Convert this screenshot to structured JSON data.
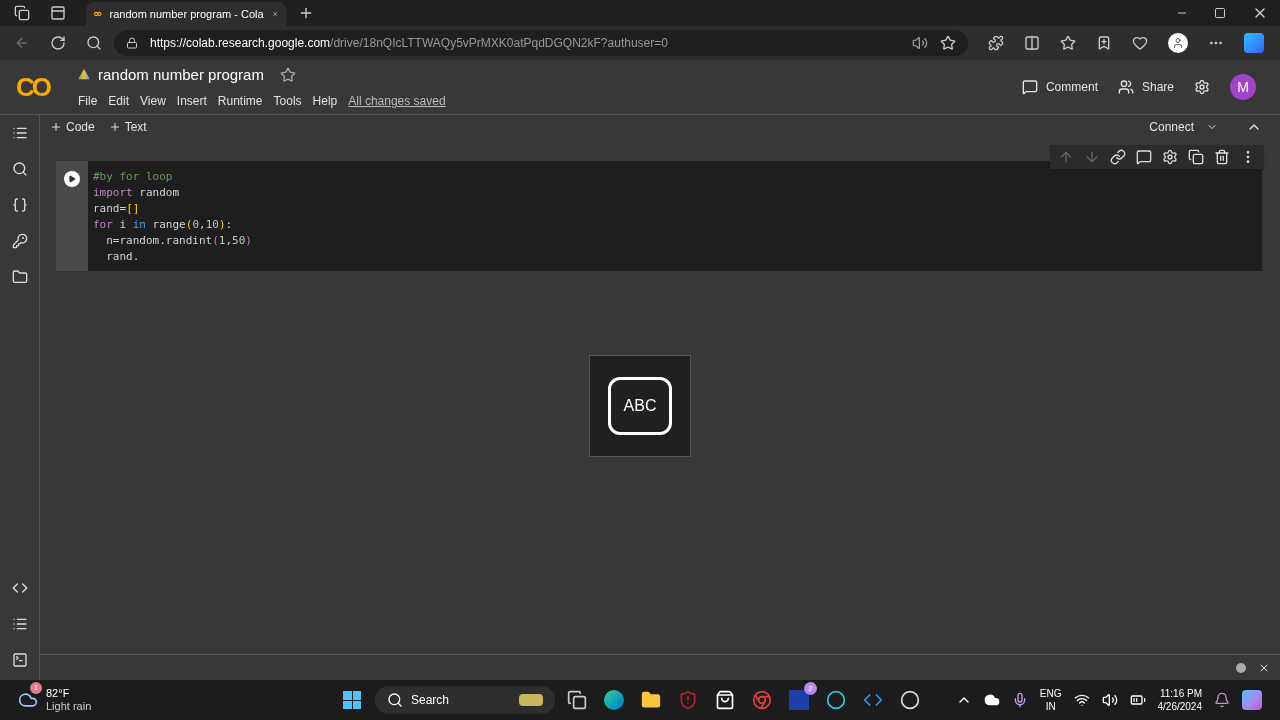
{
  "browser": {
    "tab": {
      "title": "random number program - Cola",
      "selected": true
    },
    "url": {
      "host": "https://colab.research.google.com",
      "path": "/drive/18nQIcLTTWAQy5vPrMXK0atPqdDGQN2kF?authuser=0"
    }
  },
  "notebook": {
    "logo": "CO",
    "title": "random number program",
    "menu": [
      "File",
      "Edit",
      "View",
      "Insert",
      "Runtime",
      "Tools",
      "Help"
    ],
    "save_status": "All changes saved",
    "comment": "Comment",
    "share": "Share",
    "avatar": "M"
  },
  "toolbar": {
    "add": [
      "Code",
      "Text"
    ],
    "connect": "Connect"
  },
  "cell": {
    "lines": [
      [
        {
          "text": "#by for loop",
          "kind": "comment"
        }
      ],
      [
        {
          "text": "import",
          "kind": "keyword"
        },
        {
          "text": " random",
          "kind": "plain"
        }
      ],
      [
        {
          "text": "rand=",
          "kind": "plain"
        },
        {
          "text": "[]",
          "kind": "bracket"
        }
      ],
      [
        {
          "text": "for",
          "kind": "keyword"
        },
        {
          "text": " i ",
          "kind": "plain"
        },
        {
          "text": "in",
          "kind": "operator"
        },
        {
          "text": " range",
          "kind": "plain"
        },
        {
          "text": "(",
          "kind": "bracket"
        },
        {
          "text": "0",
          "kind": "number"
        },
        {
          "text": ",",
          "kind": "plain"
        },
        {
          "text": "10",
          "kind": "number"
        },
        {
          "text": ")",
          "kind": "bracket"
        },
        {
          "text": ":",
          "kind": "plain"
        }
      ],
      [
        {
          "text": "  n=random.randint",
          "kind": "plain"
        },
        {
          "text": "(",
          "kind": "paren"
        },
        {
          "text": "1",
          "kind": "number"
        },
        {
          "text": ",",
          "kind": "plain"
        },
        {
          "text": "50",
          "kind": "number"
        },
        {
          "text": ")",
          "kind": "paren"
        }
      ],
      [
        {
          "text": "  rand.",
          "kind": "plain"
        }
      ]
    ]
  },
  "overlay": {
    "label": "ABC"
  },
  "taskbar": {
    "weather": {
      "badge": "1",
      "temp": "82°F",
      "desc": "Light rain"
    },
    "search": "Search",
    "app_badge": "2",
    "lang": [
      "ENG",
      "IN"
    ],
    "time": "11:16 PM",
    "date": "4/26/2024"
  }
}
